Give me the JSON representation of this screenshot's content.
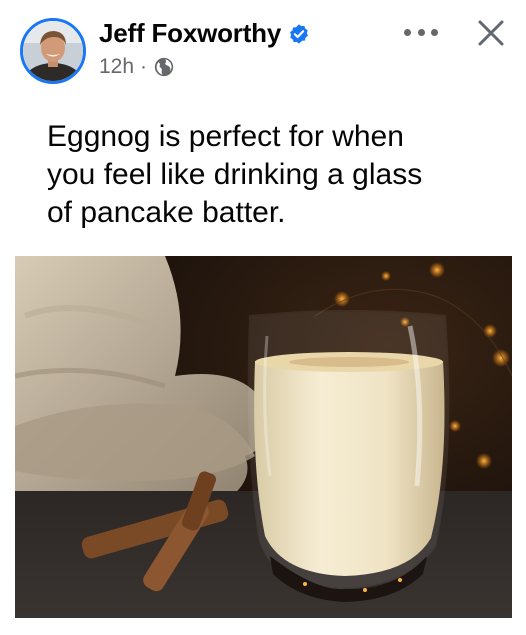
{
  "post": {
    "author": "Jeff Foxworthy",
    "time": "12h",
    "separator": "·",
    "audience_icon": "globe-icon",
    "verified_icon": "verified-badge-icon",
    "more_icon": "more-options-icon",
    "close_icon": "close-icon",
    "text": "Eggnog is perfect for when\nyou feel like drinking a glass\nof pancake batter."
  },
  "colors": {
    "verified": "#1877f2",
    "text": "#050505",
    "meta": "#65676b"
  }
}
